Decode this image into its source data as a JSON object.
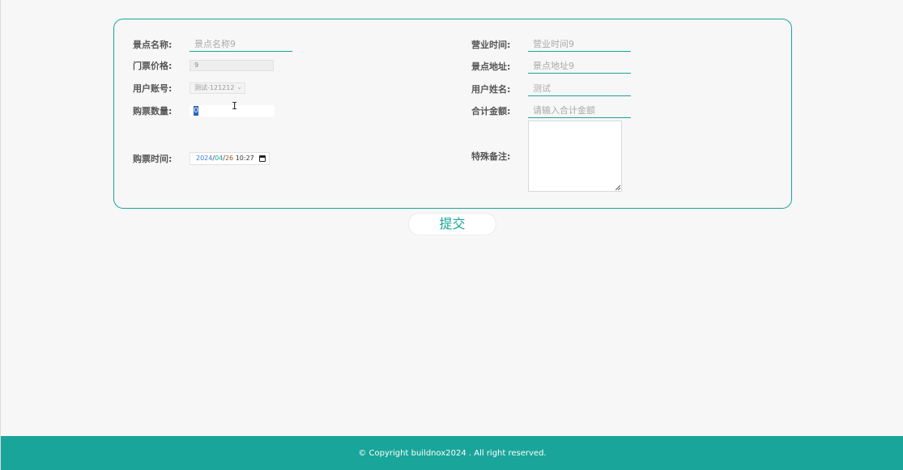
{
  "form": {
    "spot_name": {
      "label": "景点名称:",
      "placeholder": "景点名称9"
    },
    "ticket_price": {
      "label": "门票价格:",
      "value": "9"
    },
    "user_account": {
      "label": "用户账号:",
      "value": "测试-121212"
    },
    "quantity": {
      "label": "购票数量:",
      "value": "0"
    },
    "purchase_time": {
      "label": "购票时间:",
      "year": "2024",
      "month": "04",
      "day": "26",
      "time": "10:27"
    },
    "business_hours": {
      "label": "营业时间:",
      "placeholder": "营业时间9"
    },
    "spot_address": {
      "label": "景点地址:",
      "placeholder": "景点地址9"
    },
    "user_name": {
      "label": "用户姓名:",
      "placeholder": "测试"
    },
    "total_amount": {
      "label": "合计金额:",
      "placeholder": "请输入合计金额"
    },
    "remarks": {
      "label": "特殊备注:",
      "value": ""
    }
  },
  "actions": {
    "submit_label": "提交"
  },
  "footer": {
    "copyright": "© Copyright buildnox2024 . All right reserved."
  },
  "colors": {
    "accent": "#1aa59a",
    "background": "#f7f7f7"
  }
}
